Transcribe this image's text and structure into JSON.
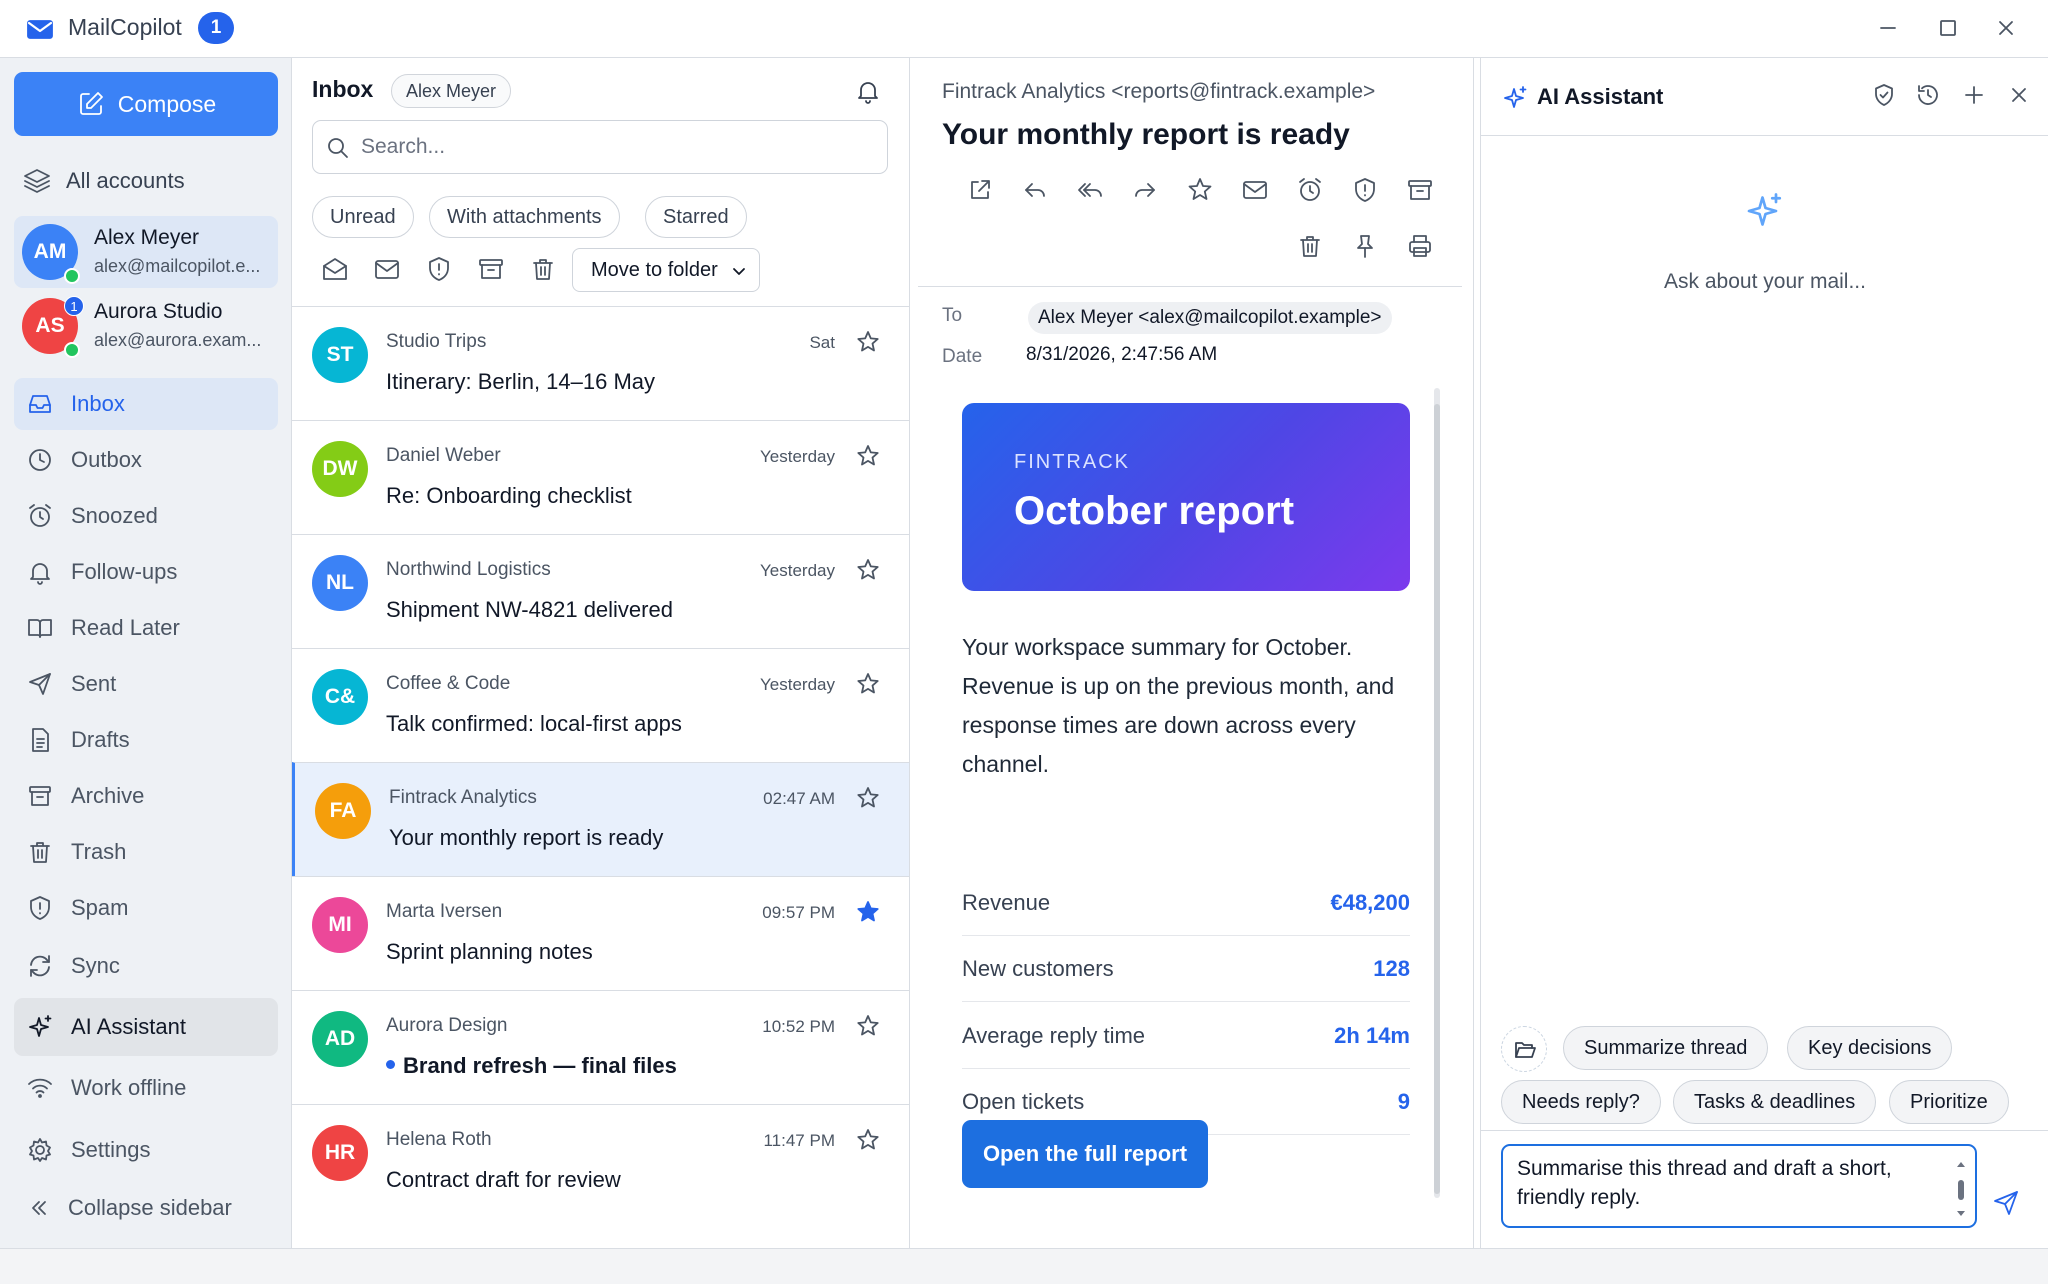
{
  "app": {
    "name": "MailCopilot",
    "badge": "1"
  },
  "sidebar": {
    "compose_label": "Compose",
    "all_accounts_label": "All accounts",
    "accounts": [
      {
        "initials": "AM",
        "name": "Alex Meyer",
        "email": "alex@mailcopilot.e...",
        "color": "#3b82f6",
        "badge": ""
      },
      {
        "initials": "AS",
        "name": "Aurora Studio",
        "email": "alex@aurora.exam...",
        "color": "#ef4444",
        "badge": "1"
      }
    ],
    "nav": [
      {
        "label": "Inbox",
        "icon": "inbox-icon"
      },
      {
        "label": "Outbox",
        "icon": "clock-icon"
      },
      {
        "label": "Snoozed",
        "icon": "alarm-icon"
      },
      {
        "label": "Follow-ups",
        "icon": "bell-icon"
      },
      {
        "label": "Read Later",
        "icon": "book-icon"
      },
      {
        "label": "Sent",
        "icon": "send-icon"
      },
      {
        "label": "Drafts",
        "icon": "file-icon"
      },
      {
        "label": "Archive",
        "icon": "archive-icon"
      },
      {
        "label": "Trash",
        "icon": "trash-icon"
      },
      {
        "label": "Spam",
        "icon": "shield-icon"
      },
      {
        "label": "Sync",
        "icon": "sync-icon"
      },
      {
        "label": "AI Assistant",
        "icon": "sparkles-icon"
      },
      {
        "label": "Work offline",
        "icon": "wifi-icon"
      },
      {
        "label": "Settings",
        "icon": "gear-icon"
      },
      {
        "label": "Collapse sidebar",
        "icon": "chevrons-left-icon"
      }
    ]
  },
  "list": {
    "title": "Inbox",
    "account_chip": "Alex Meyer",
    "search_placeholder": "Search...",
    "filters": [
      "Unread",
      "With attachments",
      "Starred"
    ],
    "move_to_folder": "Move to folder",
    "messages": [
      {
        "initials": "ST",
        "color": "#06b6d4",
        "sender": "Studio Trips",
        "time": "Sat",
        "subject": "Itinerary: Berlin, 14–16 May",
        "starred": false,
        "unread": false
      },
      {
        "initials": "DW",
        "color": "#84cc16",
        "sender": "Daniel Weber",
        "time": "Yesterday",
        "subject": "Re: Onboarding checklist",
        "starred": false,
        "unread": false
      },
      {
        "initials": "NL",
        "color": "#3b82f6",
        "sender": "Northwind Logistics",
        "time": "Yesterday",
        "subject": "Shipment NW-4821 delivered",
        "starred": false,
        "unread": false
      },
      {
        "initials": "C&",
        "color": "#06b6d4",
        "sender": "Coffee & Code",
        "time": "Yesterday",
        "subject": "Talk confirmed: local-first apps",
        "starred": false,
        "unread": false
      },
      {
        "initials": "FA",
        "color": "#f59e0b",
        "sender": "Fintrack Analytics",
        "time": "02:47 AM",
        "subject": "Your monthly report is ready",
        "starred": false,
        "unread": false
      },
      {
        "initials": "MI",
        "color": "#ec4899",
        "sender": "Marta Iversen",
        "time": "09:57 PM",
        "subject": "Sprint planning notes",
        "starred": true,
        "unread": false
      },
      {
        "initials": "AD",
        "color": "#10b981",
        "sender": "Aurora Design",
        "time": "10:52 PM",
        "subject": "Brand refresh — final files",
        "starred": false,
        "unread": true
      },
      {
        "initials": "HR",
        "color": "#ef4444",
        "sender": "Helena Roth",
        "time": "11:47 PM",
        "subject": "Contract draft for review",
        "starred": false,
        "unread": false
      }
    ]
  },
  "reader": {
    "from": "Fintrack Analytics <reports@fintrack.example>",
    "subject": "Your monthly report is ready",
    "to_label": "To",
    "to_value": "Alex Meyer <alex@mailcopilot.example>",
    "date_label": "Date",
    "date_value": "8/31/2026, 2:47:56 AM",
    "hero_kicker": "FINTRACK",
    "hero_title": "October report",
    "summary": "Your workspace summary for October. Revenue is up on the previous month, and response times are down across every channel.",
    "stats": [
      {
        "label": "Revenue",
        "value": "€48,200"
      },
      {
        "label": "New customers",
        "value": "128"
      },
      {
        "label": "Average reply time",
        "value": "2h 14m"
      },
      {
        "label": "Open tickets",
        "value": "9"
      }
    ],
    "cta": "Open the full report"
  },
  "ai": {
    "title": "AI Assistant",
    "empty_text": "Ask about your mail...",
    "suggestions": [
      "Summarize thread",
      "Key decisions",
      "Needs reply?",
      "Tasks & deadlines",
      "Prioritize"
    ],
    "input_value": "Summarise this thread and draft a short, friendly reply."
  },
  "colors": {
    "accent": "#2563eb",
    "compose": "#3b82f6",
    "selected_row": "#e8f0fc"
  }
}
